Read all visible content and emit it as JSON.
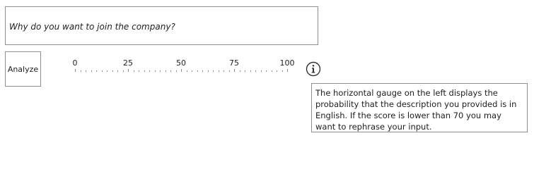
{
  "question": {
    "text": "Why do you want to join the company?"
  },
  "analyze_button": {
    "label": "Analyze"
  },
  "gauge": {
    "min": 0,
    "max": 100,
    "major_ticks": [
      0,
      25,
      50,
      75,
      100
    ],
    "minor_step": 2.5,
    "labels": [
      "0",
      "25",
      "50",
      "75",
      "100"
    ]
  },
  "info": {
    "icon": "info-icon",
    "tooltip": "The horizontal gauge on the left displays the probability that the description you provided is in English. If the score is lower than 70 you may want to rephrase your input."
  }
}
